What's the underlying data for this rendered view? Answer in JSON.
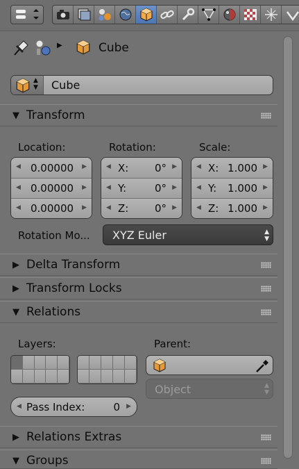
{
  "header": {
    "editor_type_icon": "properties-editor-icon",
    "tabs": [
      {
        "name": "render-icon",
        "active": false
      },
      {
        "name": "render-layers-icon",
        "active": false
      },
      {
        "name": "scene-icon",
        "active": false
      },
      {
        "name": "world-icon",
        "active": false
      },
      {
        "name": "object-icon",
        "active": true
      },
      {
        "name": "constraints-icon",
        "active": false
      },
      {
        "name": "modifiers-icon",
        "active": false
      },
      {
        "name": "object-data-icon",
        "active": false
      },
      {
        "name": "material-icon",
        "active": false
      },
      {
        "name": "texture-icon",
        "active": false
      },
      {
        "name": "particles-icon",
        "active": false
      },
      {
        "name": "physics-icon",
        "active": false
      }
    ]
  },
  "breadcrumb": {
    "object_name": "Cube"
  },
  "object_name_field": {
    "value": "Cube"
  },
  "panels": {
    "transform": {
      "title": "Transform",
      "expanded": true,
      "location_label": "Location:",
      "rotation_label": "Rotation:",
      "scale_label": "Scale:",
      "location": [
        "0.00000",
        "0.00000",
        "0.00000"
      ],
      "rotation": [
        {
          "axis": "X:",
          "value": "0°"
        },
        {
          "axis": "Y:",
          "value": "0°"
        },
        {
          "axis": "Z:",
          "value": "0°"
        }
      ],
      "scale": [
        {
          "axis": "X:",
          "value": "1.000"
        },
        {
          "axis": "Y:",
          "value": "1.000"
        },
        {
          "axis": "Z:",
          "value": "1.000"
        }
      ],
      "rotation_mode_label": "Rotation Mo...",
      "rotation_mode_value": "XYZ Euler"
    },
    "delta_transform": {
      "title": "Delta Transform",
      "expanded": false
    },
    "transform_locks": {
      "title": "Transform Locks",
      "expanded": false
    },
    "relations": {
      "title": "Relations",
      "expanded": true,
      "layers_label": "Layers:",
      "parent_label": "Parent:",
      "parent_type_value": "Object",
      "pass_index_label": "Pass Index:",
      "pass_index_value": "0"
    },
    "relations_extras": {
      "title": "Relations Extras",
      "expanded": false
    },
    "groups": {
      "title": "Groups",
      "expanded": true
    }
  },
  "colors": {
    "background": "#727272",
    "active_tab": "#5680c2",
    "cube_orange": "#e59a3a",
    "dark_field": "#3f3f3f"
  }
}
